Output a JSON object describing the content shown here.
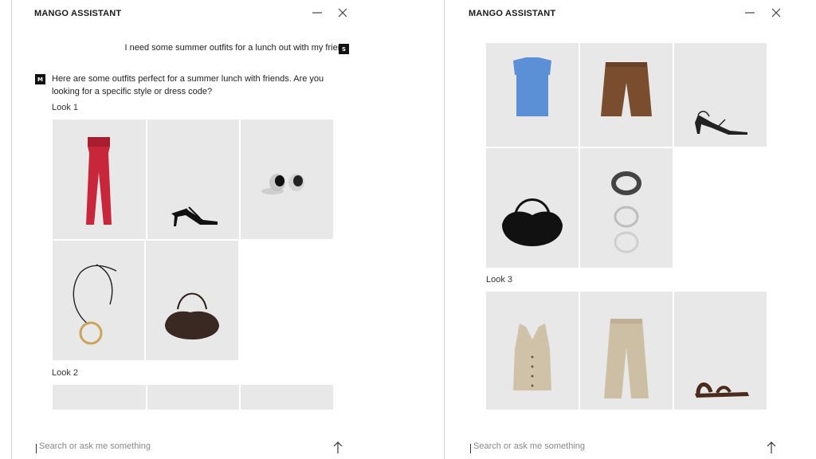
{
  "left_panel": {
    "title": "MANGO ASSISTANT",
    "user_message": "I need some summer outfits for a lunch out with my friend.",
    "user_avatar": "S",
    "assistant_avatar": "M",
    "assistant_message": "Here are some outfits perfect for a summer lunch with friends. Are you looking for a specific style or dress code?",
    "look1_label": "Look 1",
    "look2_label": "Look 2",
    "look1_items": [
      "red-jumpsuit",
      "black-strappy-heels",
      "silver-earrings",
      "cord-pendant-necklace",
      "brown-shoulder-bag"
    ],
    "search_placeholder": "Search or ask me something"
  },
  "right_panel": {
    "title": "MANGO ASSISTANT",
    "look2_items": [
      "blue-sleeveless-top",
      "brown-bermuda-shorts",
      "black-strappy-sandals",
      "black-hobo-bag",
      "bangle-bracelets"
    ],
    "look3_label": "Look 3",
    "look3_items": [
      "beige-halter-waistcoat",
      "beige-wide-trousers",
      "brown-flat-sandals"
    ],
    "search_placeholder": "Search or ask me something"
  },
  "icons": {
    "minimize": "minimize-icon",
    "close": "close-icon",
    "send": "arrow-up-icon"
  }
}
